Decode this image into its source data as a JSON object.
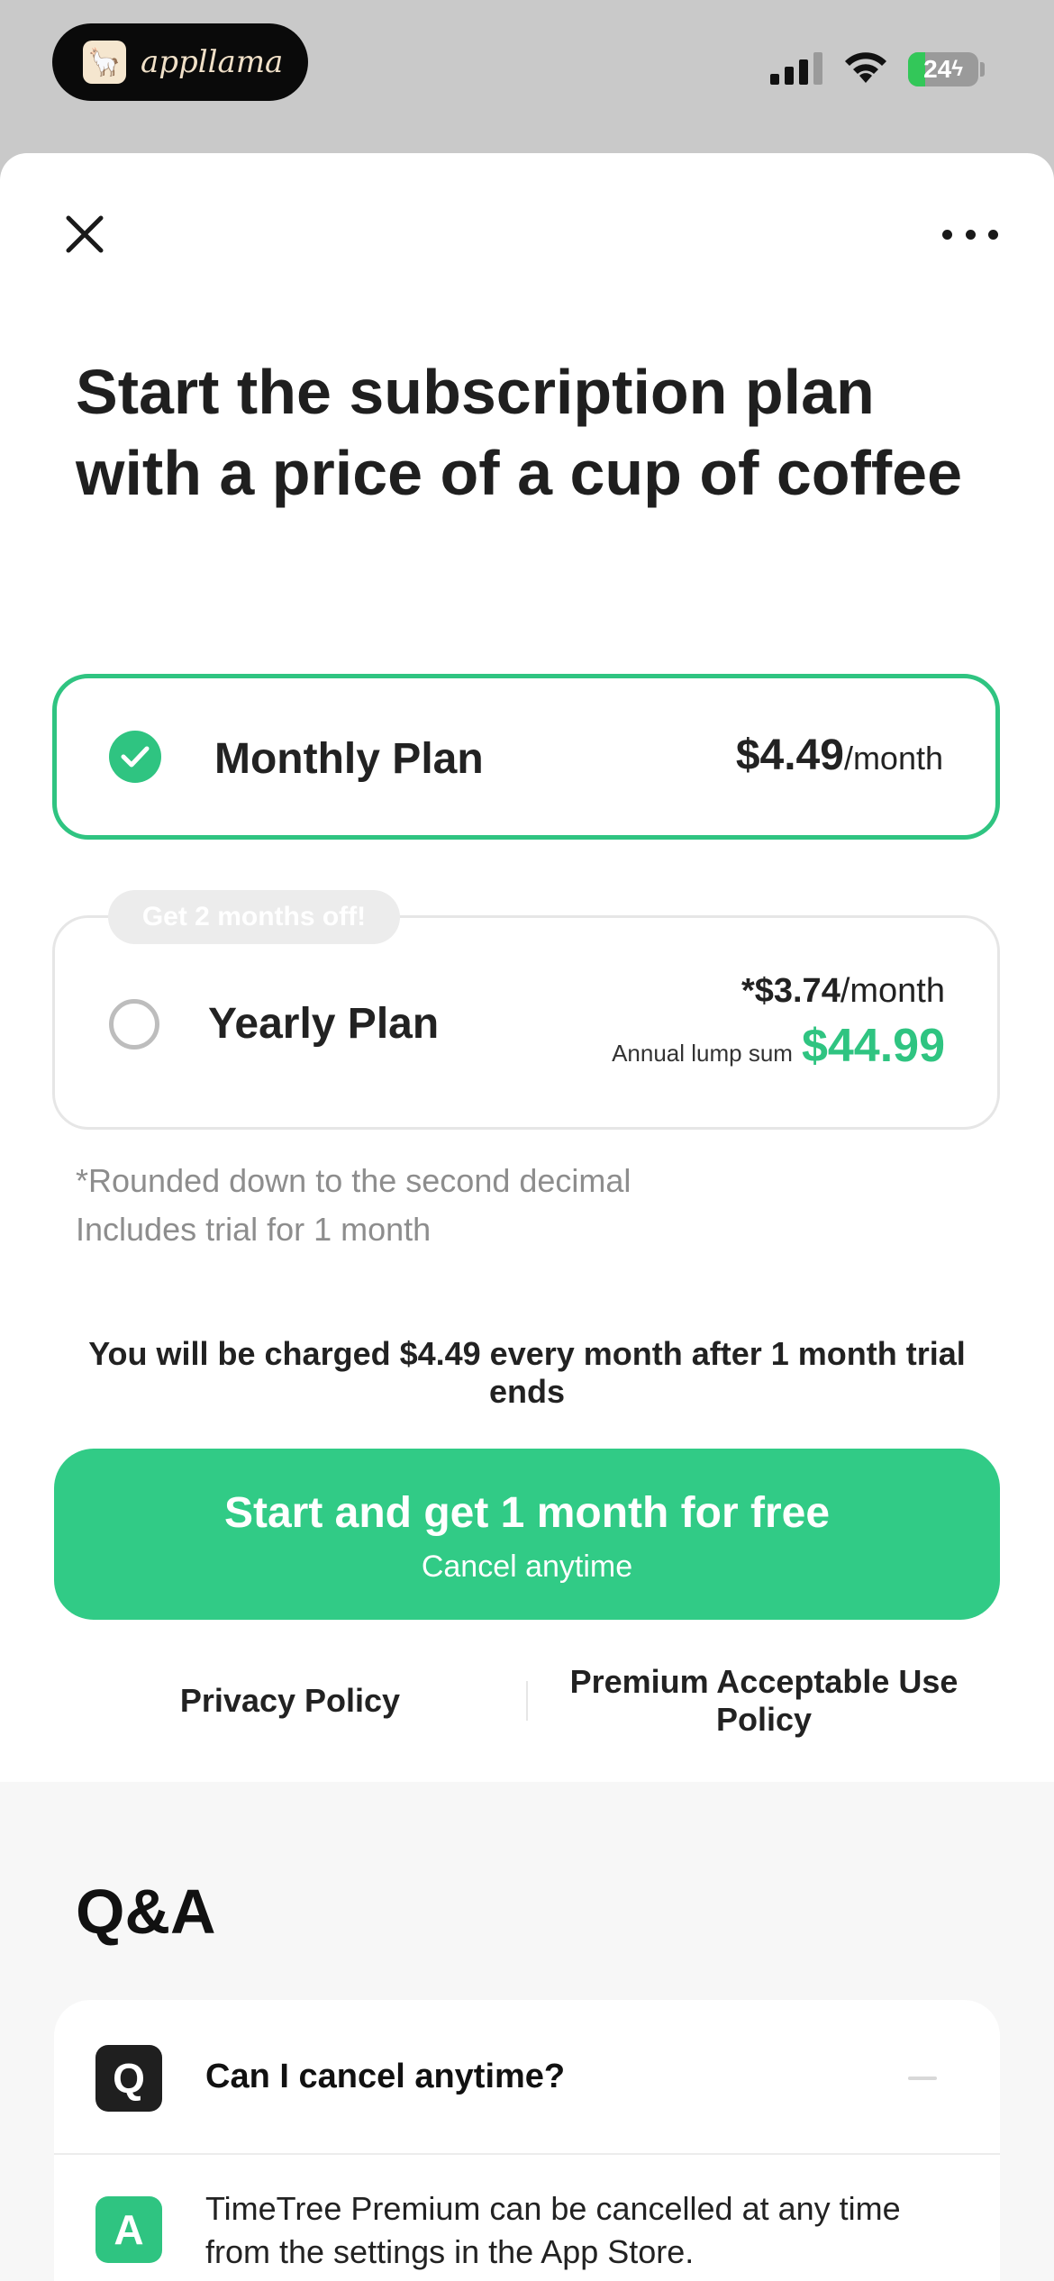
{
  "status_bar": {
    "brand": "appllama",
    "battery_level": "24",
    "battery_fraction": 0.24
  },
  "header": {
    "close_icon": "close-icon",
    "more_icon": "more-icon"
  },
  "headline": "Start the subscription plan with a price of a cup of coffee",
  "plans": {
    "monthly": {
      "name": "Monthly Plan",
      "price": "$4.49",
      "period": "/month",
      "selected": true
    },
    "yearly": {
      "badge": "Get 2 months off!",
      "name": "Yearly Plan",
      "per_month_prefix": "*",
      "per_month_price": "$3.74",
      "per_month_period": "/month",
      "lump_label": "Annual lump sum",
      "lump_price": "$44.99",
      "selected": false
    }
  },
  "notes": {
    "rounded": "*Rounded down to the second decimal",
    "trial": "Includes trial for 1 month"
  },
  "charge_text": "You will be charged $4.49 every month after 1 month trial ends",
  "cta": {
    "title": "Start and get 1 month for free",
    "subtitle": "Cancel anytime"
  },
  "links": {
    "privacy": "Privacy Policy",
    "acceptable_use": "Premium Acceptable Use Policy"
  },
  "qa": {
    "title": "Q&A",
    "items": [
      {
        "q_icon": "Q",
        "question": "Can I cancel anytime?",
        "a_icon": "A",
        "answer": "TimeTree Premium can be cancelled at any time from the settings in the App Store."
      }
    ]
  },
  "colors": {
    "accent": "#2fc481",
    "cta": "#31cb86",
    "status_bg": "#c9c9c9"
  }
}
